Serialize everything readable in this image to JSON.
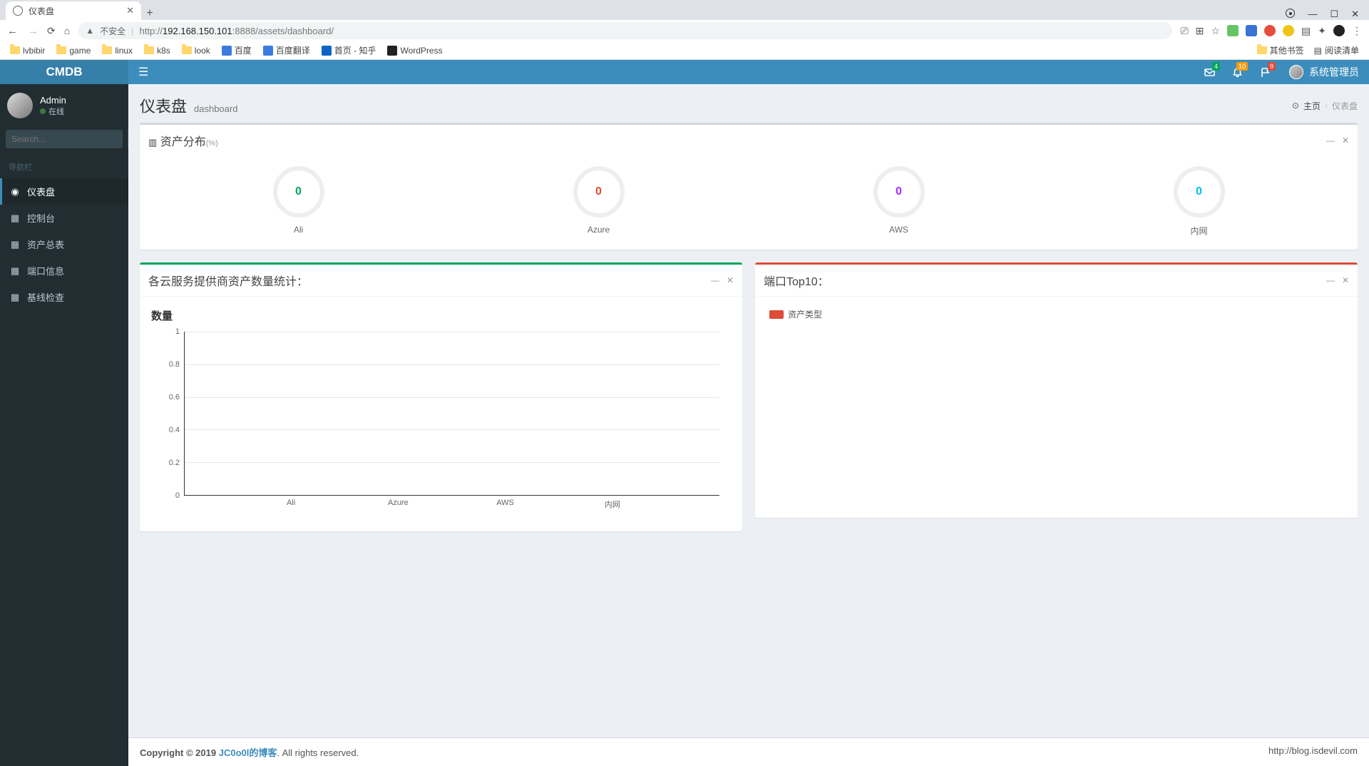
{
  "browser": {
    "tab_title": "仪表盘",
    "url_insecure_label": "不安全",
    "url_prefix": "http://",
    "url_host": "192.168.150.101",
    "url_path": ":8888/assets/dashboard/",
    "bookmarks": [
      "lvbibir",
      "game",
      "linux",
      "k8s",
      "look"
    ],
    "bookmark_links": [
      {
        "label": "百度"
      },
      {
        "label": "百度翻译"
      },
      {
        "label": "首页 - 知乎"
      },
      {
        "label": "WordPress"
      }
    ],
    "bookmark_right": [
      "其他书签",
      "阅读清单"
    ]
  },
  "app": {
    "logo": "CMDB",
    "nav_badges": {
      "mail": "4",
      "bell": "10",
      "flag": "9"
    },
    "nav_user": "系统管理员"
  },
  "sidebar": {
    "user_name": "Admin",
    "user_status": "在线",
    "search_placeholder": "Search...",
    "nav_header": "导航栏",
    "items": [
      {
        "icon": "dashboard",
        "label": "仪表盘",
        "active": true
      },
      {
        "icon": "table",
        "label": "控制台",
        "active": false
      },
      {
        "icon": "table",
        "label": "资产总表",
        "active": false
      },
      {
        "icon": "table",
        "label": "端口信息",
        "active": false
      },
      {
        "icon": "table",
        "label": "基线检查",
        "active": false
      }
    ]
  },
  "page": {
    "title": "仪表盘",
    "subtitle": "dashboard",
    "breadcrumb_home": "主页",
    "breadcrumb_current": "仪表盘"
  },
  "dist_panel": {
    "title": "资产分布",
    "title_unit": "(%)",
    "items": [
      {
        "value": "0",
        "label": "Ali",
        "color": "#00a65a"
      },
      {
        "value": "0",
        "label": "Azure",
        "color": "#dd4b39"
      },
      {
        "value": "0",
        "label": "AWS",
        "color": "#9b30ff"
      },
      {
        "value": "0",
        "label": "内网",
        "color": "#00c0ef"
      }
    ]
  },
  "chart_panel": {
    "title": "各云服务提供商资产数量统计："
  },
  "port_panel": {
    "title": "端口Top10：",
    "legend_label": "资产类型",
    "legend_color": "#dd4b39"
  },
  "chart_data": {
    "type": "bar",
    "title": "数量",
    "categories": [
      "Ali",
      "Azure",
      "AWS",
      "内网"
    ],
    "values": [
      0,
      0,
      0,
      0
    ],
    "ylim": [
      0,
      1
    ],
    "yticks": [
      0,
      0.2,
      0.4,
      0.6,
      0.8,
      1
    ],
    "xlabel": "",
    "ylabel": ""
  },
  "footer": {
    "copyright_prefix": "Copyright © 2019 ",
    "link_text": "JC0o0l的博客",
    "copyright_suffix": ". All rights reserved.",
    "right_text": "http://blog.isdevil.com"
  }
}
